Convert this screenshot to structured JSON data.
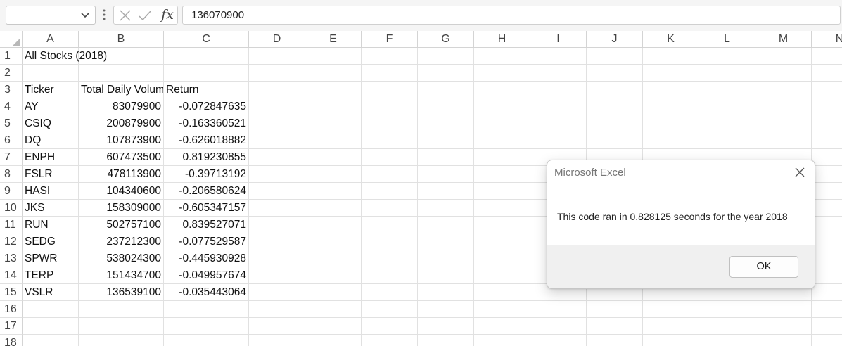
{
  "formula_bar": {
    "name_box_value": "",
    "cancel_icon": "x-icon",
    "enter_icon": "check-icon",
    "function_label": "fx",
    "formula_value": "136070900"
  },
  "columns": [
    "A",
    "B",
    "C",
    "D",
    "E",
    "F",
    "G",
    "H",
    "I",
    "J",
    "K",
    "L",
    "M",
    "N"
  ],
  "rows": [
    "1",
    "2",
    "3",
    "4",
    "5",
    "6",
    "7",
    "8",
    "9",
    "10",
    "11",
    "12",
    "13",
    "14",
    "15",
    "16",
    "17",
    "18"
  ],
  "sheet": {
    "title": "All Stocks (2018)",
    "headers": [
      "Ticker",
      "Total Daily Volume",
      "Return"
    ],
    "data": [
      [
        "AY",
        "83079900",
        "-0.072847635"
      ],
      [
        "CSIQ",
        "200879900",
        "-0.163360521"
      ],
      [
        "DQ",
        "107873900",
        "-0.626018882"
      ],
      [
        "ENPH",
        "607473500",
        "0.819230855"
      ],
      [
        "FSLR",
        "478113900",
        "-0.39713192"
      ],
      [
        "HASI",
        "104340600",
        "-0.206580624"
      ],
      [
        "JKS",
        "158309000",
        "-0.605347157"
      ],
      [
        "RUN",
        "502757100",
        "0.839527071"
      ],
      [
        "SEDG",
        "237212300",
        "-0.077529587"
      ],
      [
        "SPWR",
        "538024300",
        "-0.445930928"
      ],
      [
        "TERP",
        "151434700",
        "-0.049957674"
      ],
      [
        "VSLR",
        "136539100",
        "-0.035443064"
      ]
    ]
  },
  "dialog": {
    "title": "Microsoft Excel",
    "message": "This code ran in 0.828125 seconds for the year 2018",
    "ok_label": "OK",
    "close_icon": "close-icon"
  }
}
